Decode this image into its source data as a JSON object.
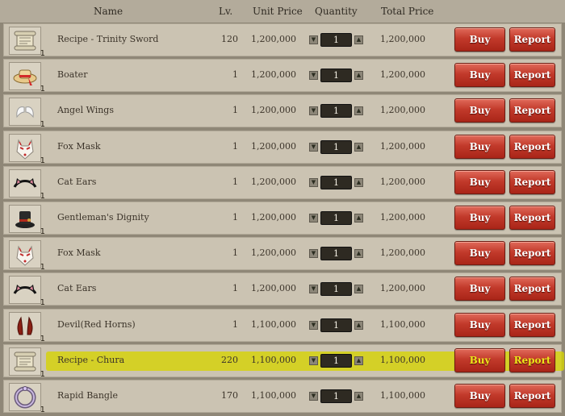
{
  "header": {
    "name": "Name",
    "level": "Lv.",
    "unit_price": "Unit Price",
    "quantity": "Quantity",
    "total_price": "Total Price"
  },
  "buttons": {
    "buy": "Buy",
    "report": "Report"
  },
  "highlight_color": "#d6d400",
  "rows": [
    {
      "icon": "scroll-recipe-icon",
      "count": "1",
      "name": "Recipe - Trinity Sword",
      "level": "120",
      "unit_price": "1,200,000",
      "quantity": "1",
      "total": "1,200,000",
      "highlighted": false
    },
    {
      "icon": "boater-hat-icon",
      "count": "1",
      "name": "Boater",
      "level": "1",
      "unit_price": "1,200,000",
      "quantity": "1",
      "total": "1,200,000",
      "highlighted": false
    },
    {
      "icon": "angel-wings-icon",
      "count": "1",
      "name": "Angel Wings",
      "level": "1",
      "unit_price": "1,200,000",
      "quantity": "1",
      "total": "1,200,000",
      "highlighted": false
    },
    {
      "icon": "fox-mask-icon",
      "count": "1",
      "name": "Fox Mask",
      "level": "1",
      "unit_price": "1,200,000",
      "quantity": "1",
      "total": "1,200,000",
      "highlighted": false
    },
    {
      "icon": "cat-ears-icon",
      "count": "1",
      "name": "Cat Ears",
      "level": "1",
      "unit_price": "1,200,000",
      "quantity": "1",
      "total": "1,200,000",
      "highlighted": false
    },
    {
      "icon": "top-hat-icon",
      "count": "1",
      "name": "Gentleman's Dignity",
      "level": "1",
      "unit_price": "1,200,000",
      "quantity": "1",
      "total": "1,200,000",
      "highlighted": false
    },
    {
      "icon": "fox-mask-icon",
      "count": "1",
      "name": "Fox Mask",
      "level": "1",
      "unit_price": "1,200,000",
      "quantity": "1",
      "total": "1,200,000",
      "highlighted": false
    },
    {
      "icon": "cat-ears-icon",
      "count": "1",
      "name": "Cat Ears",
      "level": "1",
      "unit_price": "1,200,000",
      "quantity": "1",
      "total": "1,200,000",
      "highlighted": false
    },
    {
      "icon": "devil-horns-icon",
      "count": "1",
      "name": "Devil(Red Horns)",
      "level": "1",
      "unit_price": "1,100,000",
      "quantity": "1",
      "total": "1,100,000",
      "highlighted": false
    },
    {
      "icon": "scroll-recipe-icon",
      "count": "1",
      "name": "Recipe - Chura",
      "level": "220",
      "unit_price": "1,100,000",
      "quantity": "1",
      "total": "1,100,000",
      "highlighted": true
    },
    {
      "icon": "bangle-icon",
      "count": "1",
      "name": "Rapid Bangle",
      "level": "170",
      "unit_price": "1,100,000",
      "quantity": "1",
      "total": "1,100,000",
      "highlighted": false
    }
  ]
}
